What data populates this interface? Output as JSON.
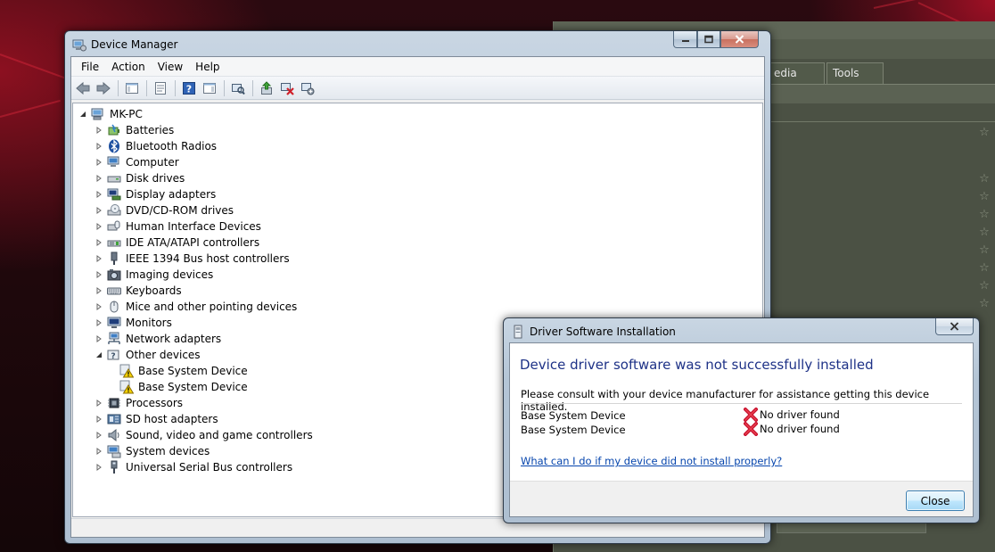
{
  "background_window": {
    "tabs": [
      "edia",
      "Tools"
    ]
  },
  "device_manager": {
    "title": "Device Manager",
    "menu": [
      "File",
      "Action",
      "View",
      "Help"
    ],
    "toolbar": [
      "back-icon",
      "forward-icon",
      "show-hide-console-tree-icon",
      "properties-icon",
      "help-icon",
      "action-pane-icon",
      "scan-hardware-icon",
      "update-driver-icon",
      "uninstall-icon",
      "disable-icon"
    ],
    "tree": {
      "root": "MK-PC",
      "categories": [
        {
          "label": "Batteries",
          "icon": "battery-icon"
        },
        {
          "label": "Bluetooth Radios",
          "icon": "bluetooth-icon"
        },
        {
          "label": "Computer",
          "icon": "computer-icon"
        },
        {
          "label": "Disk drives",
          "icon": "disk-drive-icon"
        },
        {
          "label": "Display adapters",
          "icon": "display-adapter-icon"
        },
        {
          "label": "DVD/CD-ROM drives",
          "icon": "dvd-drive-icon"
        },
        {
          "label": "Human Interface Devices",
          "icon": "hid-icon"
        },
        {
          "label": "IDE ATA/ATAPI controllers",
          "icon": "ide-controller-icon"
        },
        {
          "label": "IEEE 1394 Bus host controllers",
          "icon": "firewire-icon"
        },
        {
          "label": "Imaging devices",
          "icon": "camera-icon"
        },
        {
          "label": "Keyboards",
          "icon": "keyboard-icon"
        },
        {
          "label": "Mice and other pointing devices",
          "icon": "mouse-icon"
        },
        {
          "label": "Monitors",
          "icon": "monitor-icon"
        },
        {
          "label": "Network adapters",
          "icon": "network-adapter-icon"
        },
        {
          "label": "Other devices",
          "icon": "other-devices-icon",
          "expanded": true,
          "children": [
            "Base System Device",
            "Base System Device"
          ]
        },
        {
          "label": "Processors",
          "icon": "processor-icon"
        },
        {
          "label": "SD host adapters",
          "icon": "sd-host-icon"
        },
        {
          "label": "Sound, video and game controllers",
          "icon": "sound-icon"
        },
        {
          "label": "System devices",
          "icon": "system-devices-icon"
        },
        {
          "label": "Universal Serial Bus controllers",
          "icon": "usb-icon"
        }
      ]
    }
  },
  "driver_dialog": {
    "title": "Driver Software Installation",
    "heading": "Device driver software was not successfully installed",
    "message": "Please consult with your device manufacturer for assistance getting this device installed.",
    "devices": [
      {
        "name": "Base System Device",
        "status": "No driver found"
      },
      {
        "name": "Base System Device",
        "status": "No driver found"
      }
    ],
    "help_link": "What can I do if my device did not install properly?",
    "close_button": "Close"
  },
  "colors": {
    "heading_blue": "#1e3287",
    "link_blue": "#0645ad",
    "error_red": "#c8102e"
  }
}
